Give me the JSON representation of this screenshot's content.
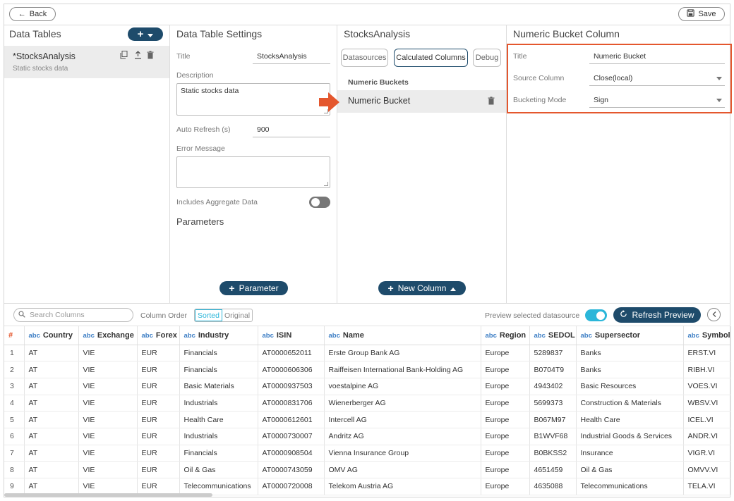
{
  "topbar": {
    "back_label": "Back",
    "save_label": "Save"
  },
  "data_tables": {
    "title": "Data Tables",
    "add_label": "+",
    "item": {
      "name": "*StocksAnalysis",
      "subtitle": "Static stocks data"
    }
  },
  "settings": {
    "title": "Data Table Settings",
    "title_label": "Title",
    "title_value": "StocksAnalysis",
    "description_label": "Description",
    "description_value": "Static stocks data",
    "auto_refresh_label": "Auto Refresh (s)",
    "auto_refresh_value": "900",
    "error_label": "Error Message",
    "aggregate_label": "Includes Aggregate Data",
    "aggregate_on": false,
    "parameters_title": "Parameters",
    "parameter_button": "Parameter"
  },
  "stocks": {
    "title": "StocksAnalysis",
    "tabs": [
      "Datasources",
      "Calculated Columns",
      "Debug"
    ],
    "active_tab": "Calculated Columns",
    "section_label": "Numeric Buckets",
    "item_label": "Numeric Bucket",
    "new_column_button": "New Column"
  },
  "bucket": {
    "title": "Numeric Bucket Column",
    "title_label": "Title",
    "title_value": "Numeric Bucket",
    "source_label": "Source Column",
    "source_value": "Close(local)",
    "mode_label": "Bucketing Mode",
    "mode_value": "Sign",
    "highlight_color": "#e4572e"
  },
  "preview": {
    "search_placeholder": "Search Columns",
    "column_order_label": "Column Order",
    "sorted_label": "Sorted",
    "original_label": "Original",
    "preview_label": "Preview selected datasource",
    "preview_on": true,
    "refresh_label": "Refresh Preview"
  },
  "table": {
    "type_prefix": "abc",
    "index_header": "#",
    "columns": [
      "Country",
      "Exchange",
      "Forex",
      "Industry",
      "ISIN",
      "Name",
      "Region",
      "SEDOL",
      "Supersector",
      "Symbol"
    ],
    "rows": [
      [
        "1",
        "AT",
        "VIE",
        "EUR",
        "Financials",
        "AT0000652011",
        "Erste Group Bank AG",
        "Europe",
        "5289837",
        "Banks",
        "ERST.VI"
      ],
      [
        "2",
        "AT",
        "VIE",
        "EUR",
        "Financials",
        "AT0000606306",
        "Raiffeisen International Bank-Holding AG",
        "Europe",
        "B0704T9",
        "Banks",
        "RIBH.VI"
      ],
      [
        "3",
        "AT",
        "VIE",
        "EUR",
        "Basic Materials",
        "AT0000937503",
        "voestalpine AG",
        "Europe",
        "4943402",
        "Basic Resources",
        "VOES.VI"
      ],
      [
        "4",
        "AT",
        "VIE",
        "EUR",
        "Industrials",
        "AT0000831706",
        "Wienerberger AG",
        "Europe",
        "5699373",
        "Construction & Materials",
        "WBSV.VI"
      ],
      [
        "5",
        "AT",
        "VIE",
        "EUR",
        "Health Care",
        "AT0000612601",
        "Intercell AG",
        "Europe",
        "B067M97",
        "Health Care",
        "ICEL.VI"
      ],
      [
        "6",
        "AT",
        "VIE",
        "EUR",
        "Industrials",
        "AT0000730007",
        "Andritz AG",
        "Europe",
        "B1WVF68",
        "Industrial Goods & Services",
        "ANDR.VI"
      ],
      [
        "7",
        "AT",
        "VIE",
        "EUR",
        "Financials",
        "AT0000908504",
        "Vienna Insurance Group",
        "Europe",
        "B0BKSS2",
        "Insurance",
        "VIGR.VI"
      ],
      [
        "8",
        "AT",
        "VIE",
        "EUR",
        "Oil & Gas",
        "AT0000743059",
        "OMV AG",
        "Europe",
        "4651459",
        "Oil & Gas",
        "OMVV.VI"
      ],
      [
        "9",
        "AT",
        "VIE",
        "EUR",
        "Telecommunications",
        "AT0000720008",
        "Telekom Austria AG",
        "Europe",
        "4635088",
        "Telecommunications",
        "TELA.VI"
      ]
    ]
  }
}
